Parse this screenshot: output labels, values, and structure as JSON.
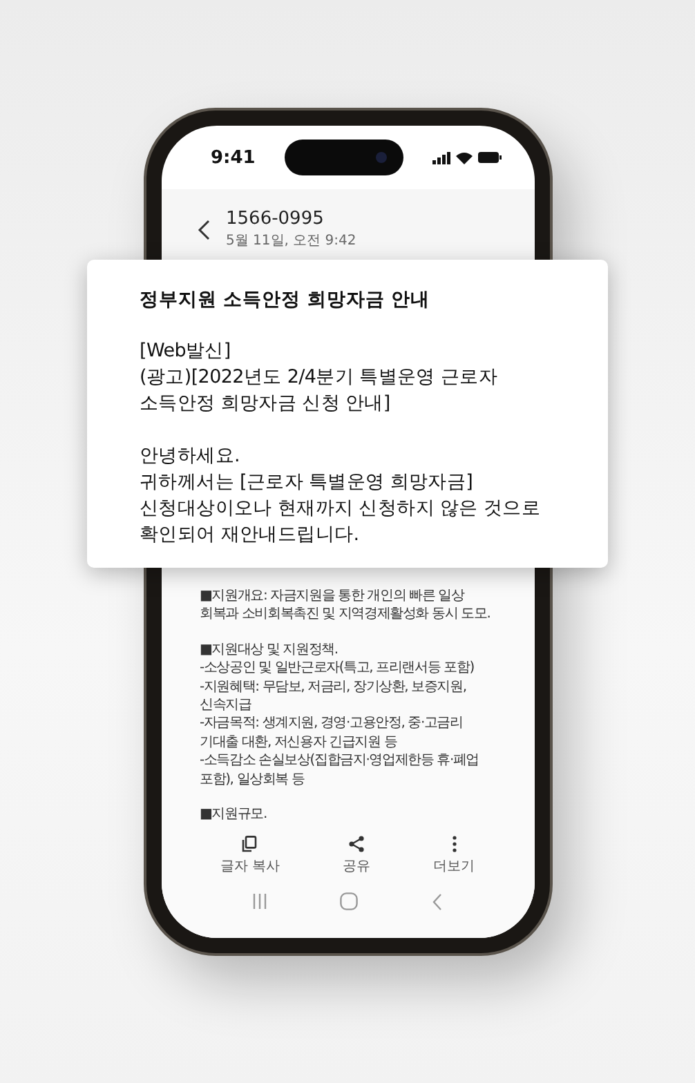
{
  "status_bar": {
    "time": "9:41"
  },
  "header": {
    "sender": "1566-0995",
    "date": "5월 11일, 오전 9:42"
  },
  "message_paragraphs": [
    [
      "■지원개요: 자금지원을 통한 개인의 빠른 일상",
      "회복과 소비회복촉진 및 지역경제활성화 동시 도모."
    ],
    [
      "■지원대상 및 지원정책.",
      "-소상공인 및 일반근로자(특고, 프리랜서등 포함)",
      "-지원혜택: 무담보, 저금리, 장기상환, 보증지원,",
      "신속지급",
      "-자금목적: 생계지원, 경영·고용안정, 중·고금리",
      "기대출 대환, 저신용자 긴급지원 등",
      "-소득감소 손실보상(집합금지·영업제한등 휴·폐업",
      "포함), 일상회복 등"
    ],
    [
      "■지원규모."
    ]
  ],
  "popup": {
    "title": "정부지원 소득안정 희망자금 안내",
    "paragraphs": [
      [
        "[Web발신]",
        "(광고)[2022년도 2/4분기 특별운영 근로자",
        "소득안정 희망자금 신청 안내]"
      ],
      [
        "안녕하세요.",
        "귀하께서는 [근로자 특별운영 희망자금]",
        "신청대상이오나 현재까지 신청하지 않은 것으로",
        "확인되어 재안내드립니다."
      ]
    ]
  },
  "toolbar": [
    {
      "kind": "copy",
      "label": "글자 복사"
    },
    {
      "kind": "share",
      "label": "공유"
    },
    {
      "kind": "more",
      "label": "더보기"
    }
  ]
}
